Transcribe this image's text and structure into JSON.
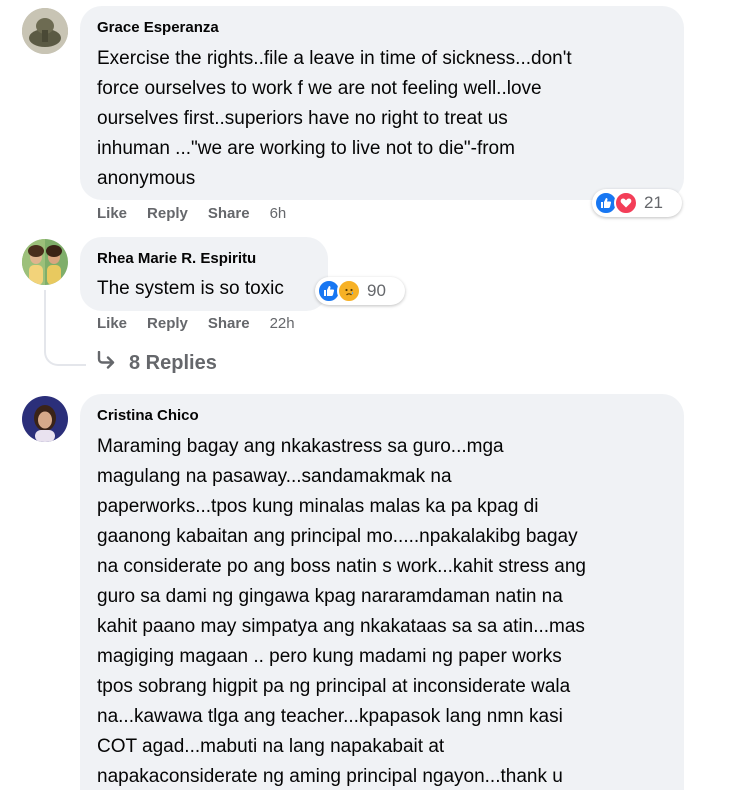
{
  "comments": [
    {
      "author": "Grace Esperanza",
      "text": "Exercise the rights..file a leave in time of sickness...don't\nforce ourselves to work f we are not feeling well..love\nourselves first..superiors have no right to treat us\ninhuman ...\"we are working to live not to die\"-from\nanonymous",
      "like_label": "Like",
      "reply_label": "Reply",
      "share_label": "Share",
      "time": "6h",
      "reaction_icons": [
        "like-icon",
        "love-icon"
      ],
      "reaction_count": "21"
    },
    {
      "author": "Rhea Marie R. Espiritu",
      "text": "The system is so toxic",
      "like_label": "Like",
      "reply_label": "Reply",
      "share_label": "Share",
      "time": "22h",
      "reaction_icons": [
        "like-icon",
        "sad-icon"
      ],
      "reaction_count": "90",
      "replies_label": "8 Replies"
    },
    {
      "author": "Cristina Chico",
      "text": "Maraming bagay ang nkakastress sa guro...mga\nmagulang na pasaway...sandamakmak na\npaperworks...tpos kung minalas malas ka pa kpag di\ngaanong kabaitan ang principal mo.....npakalakibg bagay\nna considerate po ang boss natin s work...kahit stress ang\nguro sa dami ng gingawa kpag nararamdaman natin na\nkahit paano may simpatya ang nkakataas sa sa atin...mas\nmagiging magaan .. pero kung madami ng paper works\ntpos sobrang higpit pa ng principal at inconsiderate wala\nna...kawawa tlga ang teacher...kpapasok lang nmn kasi\nCOT agad...mabuti na lang napakabait at\nnapakaconsiderate ng aming principal ngayon...thank u"
    }
  ],
  "colors": {
    "bubble": "#f0f2f5",
    "muted_text": "#65676b",
    "like_blue": "#1877f2",
    "love_red": "#f33e58",
    "sad_yellow": "#f7b125"
  }
}
